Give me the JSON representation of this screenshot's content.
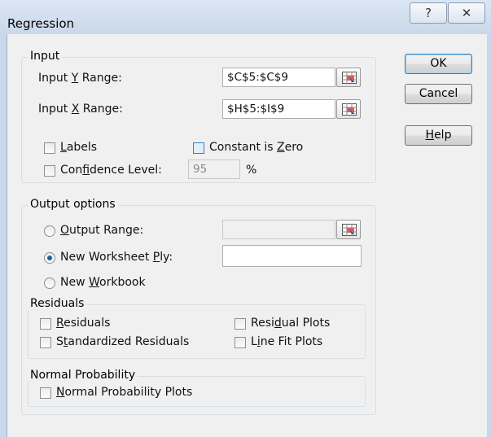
{
  "window": {
    "title": "Regression",
    "help_glyph": "?",
    "close_glyph": "✕"
  },
  "input": {
    "legend": "Input",
    "y_range": {
      "label_pre": "Input ",
      "label_key": "Y",
      "label_post": " Range:",
      "value": "$C$5:$C$9"
    },
    "x_range": {
      "label_pre": "Input ",
      "label_key": "X",
      "label_post": " Range:",
      "value": "$H$5:$I$9"
    },
    "labels": {
      "key": "L",
      "rest": "abels",
      "checked": false
    },
    "constant_zero": {
      "pre": "Constant is ",
      "key": "Z",
      "post": "ero",
      "checked": false
    },
    "confidence": {
      "pre": "Con",
      "key": "f",
      "post": "idence Level:",
      "checked": false,
      "value": "95",
      "unit": "%"
    }
  },
  "output": {
    "legend": "Output options",
    "output_range": {
      "key": "O",
      "rest": "utput Range:",
      "selected": false,
      "value": ""
    },
    "new_ply": {
      "pre": "New Worksheet ",
      "key": "P",
      "post": "ly:",
      "selected": true,
      "value": ""
    },
    "new_workbook": {
      "pre": "New ",
      "key": "W",
      "post": "orkbook",
      "selected": false
    }
  },
  "residuals": {
    "legend": "Residuals",
    "residuals": {
      "key": "R",
      "rest": "esiduals",
      "checked": false
    },
    "standardized": {
      "pre": "S",
      "key": "t",
      "post": "andardized Residuals",
      "checked": false
    },
    "residual_plots": {
      "pre": "Resi",
      "key": "d",
      "post": "ual Plots",
      "checked": false
    },
    "line_fit": {
      "pre": "L",
      "key": "i",
      "post": "ne Fit Plots",
      "checked": false
    }
  },
  "normal": {
    "legend": "Normal Probability",
    "plots": {
      "key": "N",
      "rest": "ormal Probability Plots",
      "checked": false
    }
  },
  "buttons": {
    "ok": "OK",
    "cancel": "Cancel",
    "help_key": "H",
    "help_rest": "elp"
  }
}
